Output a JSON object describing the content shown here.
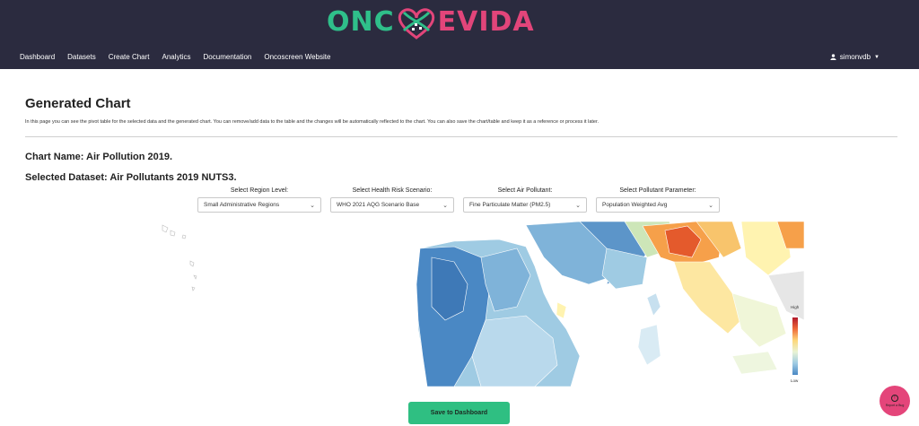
{
  "brand": {
    "left": "ONC",
    "right": "EVIDA"
  },
  "nav": {
    "items": [
      "Dashboard",
      "Datasets",
      "Create Chart",
      "Analytics",
      "Documentation",
      "Oncoscreen Website"
    ],
    "user": "simonvdb"
  },
  "page": {
    "title": "Generated Chart",
    "description": "In this page you can see the pivot table for the selected data and the generated chart. You can remove/add data to the table and the changes will be automatically reflected to the chart. You can also save the chart/table and keep it as a reference or process it later.",
    "chart_name": "Chart Name: Air Pollution 2019.",
    "dataset": "Selected Dataset: Air Pollutants 2019 NUTS3."
  },
  "selectors": [
    {
      "label": "Select Region Level:",
      "value": "Small Administrative Regions"
    },
    {
      "label": "Select Health Risk Scenario:",
      "value": "WHO 2021 AQG Scenario Base"
    },
    {
      "label": "Select Air Pollutant:",
      "value": "Fine Particulate Matter (PM2.5)"
    },
    {
      "label": "Select Pollutant Parameter:",
      "value": "Population Weighted Avg"
    }
  ],
  "legend": {
    "high": "High",
    "low": "Low"
  },
  "buttons": {
    "save": "Save to Dashboard",
    "bug": "Report a Bug"
  },
  "colors": {
    "topbar": "#2b2b3f",
    "brand_green": "#2fbf8a",
    "brand_pink": "#e2457a",
    "save": "#2fbf82"
  }
}
